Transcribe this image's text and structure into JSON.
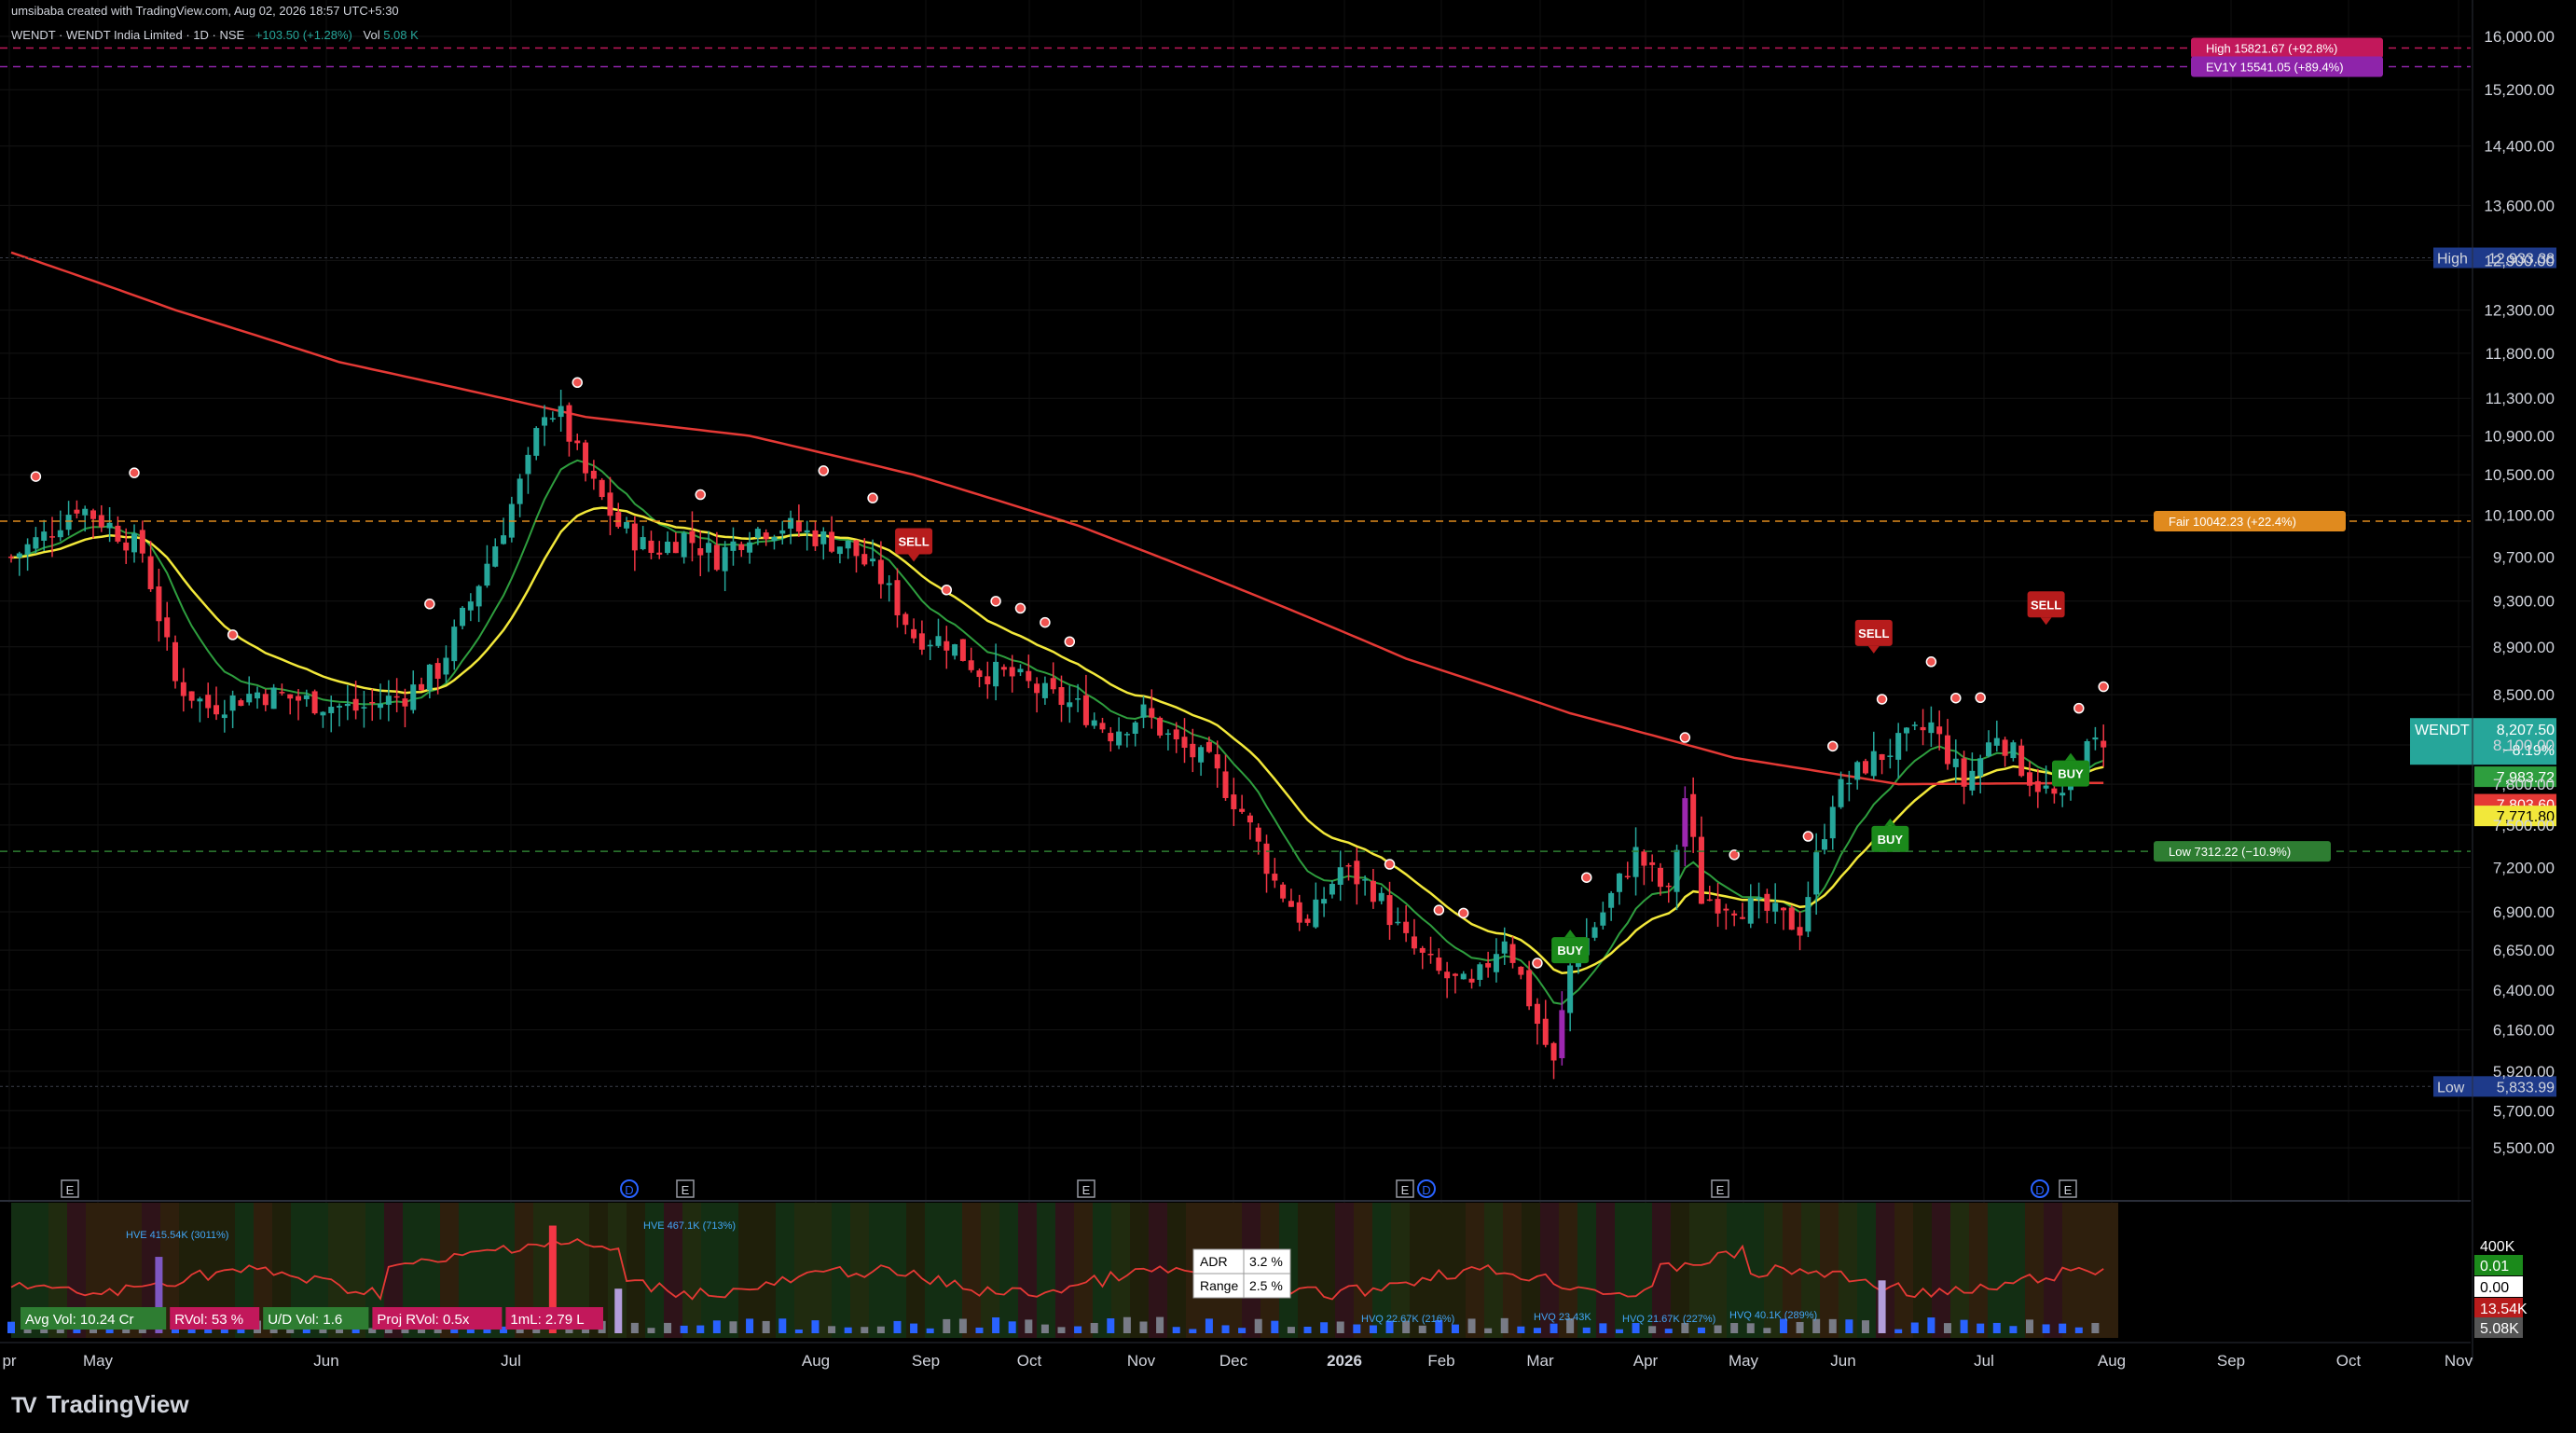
{
  "header": {
    "credit": "umsibaba created with TradingView.com, Aug 02, 2026 18:57 UTC+5:30",
    "title": "WENDT · WENDT India Limited · 1D · NSE",
    "change": "+103.50 (+1.28%)",
    "vol_label": "Vol",
    "vol_value": "5.08 K"
  },
  "brand": {
    "name": "TradingView",
    "logo": "tradingview-logo-icon"
  },
  "chart_data": {
    "type": "candlestick",
    "symbol": "WENDT",
    "y_ticks": [
      5500,
      5700,
      5920,
      6160,
      6400,
      6650,
      6900,
      7200,
      7500,
      7800,
      8100,
      8500,
      8900,
      9300,
      9700,
      10100,
      10500,
      10900,
      11300,
      11800,
      12300,
      12900,
      13600,
      14400,
      15200,
      16000
    ],
    "ylim": [
      5350,
      16100
    ],
    "scale": "log",
    "x_labels": [
      "pr",
      "May",
      "Jun",
      "Jul",
      "Aug",
      "Sep",
      "Oct",
      "Nov",
      "Dec",
      "2026",
      "Feb",
      "Mar",
      "Apr",
      "May",
      "Jun",
      "Jul",
      "Aug",
      "Sep",
      "Oct",
      "Nov"
    ],
    "series_close_anchors": [
      [
        0,
        9700
      ],
      [
        4,
        9900
      ],
      [
        8,
        10200
      ],
      [
        12,
        10000
      ],
      [
        16,
        9750
      ],
      [
        20,
        8600
      ],
      [
        24,
        8400
      ],
      [
        30,
        8520
      ],
      [
        36,
        8450
      ],
      [
        42,
        8380
      ],
      [
        48,
        8500
      ],
      [
        52,
        8700
      ],
      [
        56,
        9300
      ],
      [
        60,
        10000
      ],
      [
        63,
        10600
      ],
      [
        65,
        11200
      ],
      [
        67,
        11100
      ],
      [
        70,
        10500
      ],
      [
        74,
        10000
      ],
      [
        78,
        9750
      ],
      [
        82,
        9900
      ],
      [
        86,
        9700
      ],
      [
        90,
        9950
      ],
      [
        94,
        10000
      ],
      [
        98,
        9900
      ],
      [
        102,
        9800
      ],
      [
        106,
        9500
      ],
      [
        110,
        9000
      ],
      [
        114,
        8950
      ],
      [
        118,
        8700
      ],
      [
        122,
        8650
      ],
      [
        126,
        8500
      ],
      [
        130,
        8400
      ],
      [
        134,
        8200
      ],
      [
        138,
        8350
      ],
      [
        142,
        8100
      ],
      [
        146,
        7950
      ],
      [
        150,
        7600
      ],
      [
        154,
        7100
      ],
      [
        158,
        6800
      ],
      [
        162,
        7200
      ],
      [
        166,
        7050
      ],
      [
        170,
        6700
      ],
      [
        174,
        6500
      ],
      [
        178,
        6400
      ],
      [
        182,
        6750
      ],
      [
        186,
        6200
      ],
      [
        188,
        5950
      ],
      [
        190,
        6550
      ],
      [
        194,
        6900
      ],
      [
        198,
        7300
      ],
      [
        202,
        7000
      ],
      [
        204,
        7700
      ],
      [
        206,
        7000
      ],
      [
        210,
        6950
      ],
      [
        214,
        6900
      ],
      [
        218,
        6800
      ],
      [
        222,
        7700
      ],
      [
        226,
        7950
      ],
      [
        230,
        8100
      ],
      [
        234,
        8250
      ],
      [
        238,
        7800
      ],
      [
        242,
        8200
      ],
      [
        246,
        7850
      ],
      [
        250,
        7650
      ],
      [
        252,
        8000
      ],
      [
        256,
        8207.5
      ]
    ],
    "total_bars": 256,
    "ma_fast": {
      "name": "",
      "color": "#2e9e3e"
    },
    "ma_mid": {
      "name": "",
      "color": "#f2e83a"
    },
    "ma_slow": {
      "name": "",
      "color": "#e53935",
      "anchors": [
        [
          0,
          13000
        ],
        [
          20,
          12300
        ],
        [
          40,
          11700
        ],
        [
          55,
          11400
        ],
        [
          70,
          11100
        ],
        [
          90,
          10900
        ],
        [
          110,
          10500
        ],
        [
          130,
          10000
        ],
        [
          150,
          9400
        ],
        [
          170,
          8800
        ],
        [
          190,
          8350
        ],
        [
          210,
          8000
        ],
        [
          230,
          7800
        ],
        [
          256,
          7810
        ]
      ]
    },
    "markers": [
      {
        "type": "SELL",
        "bar": 110,
        "price": 9850
      },
      {
        "type": "SELL",
        "bar": 227,
        "price": 9020
      },
      {
        "type": "SELL",
        "bar": 248,
        "price": 9270
      },
      {
        "type": "BUY",
        "bar": 190,
        "price": 6650
      },
      {
        "type": "BUY",
        "bar": 229,
        "price": 7400
      },
      {
        "type": "BUY",
        "bar": 251,
        "price": 7880
      }
    ],
    "level_labels": [
      {
        "key": "high_ev",
        "text": "High 15821.67 (+92.8%)",
        "price": 15821.67,
        "color": "#c2185b"
      },
      {
        "key": "ev1y",
        "text": "EV1Y 15541.05 (+89.4%)",
        "price": 15541.05,
        "color": "#8e24aa",
        "icon": "diamond-icon"
      },
      {
        "key": "fair",
        "text": "Fair 10042.23 (+22.4%)",
        "price": 10042.23,
        "color": "#e08a1e"
      },
      {
        "key": "low",
        "text": "Low 7312.22 (−10.9%)",
        "price": 7312.22,
        "color": "#2e7d32"
      }
    ],
    "high_marker": {
      "label": "High",
      "value": "12,933.38",
      "price": 12933.38
    },
    "low_marker": {
      "label": "Low",
      "value": "5,833.99",
      "price": 5833.99
    },
    "price_badges": [
      {
        "text": "WENDT",
        "sub": "8,207.50",
        "sub2": "−8.19%",
        "price": 8207.5,
        "color": "#26a69a"
      },
      {
        "text": "7,983.72",
        "price": 7983.72,
        "color": "#2e9e3e"
      },
      {
        "text": "7,803.60",
        "price": 7803.6,
        "color": "#e53935"
      },
      {
        "text": "7,771.80",
        "price": 7771.8,
        "color": "#f2e83a"
      }
    ],
    "event_markers": [
      "E",
      "D",
      "E",
      "E",
      "E",
      "D",
      "E",
      "D",
      "E"
    ],
    "sub_panel": {
      "axis_labels": [
        "400K",
        "0.01",
        "0.00",
        "13.54K",
        "5.08K"
      ],
      "stats": [
        {
          "label": "Avg Vol: 10.24 Cr",
          "color": "#2e7d32"
        },
        {
          "label": "RVol: 53 %",
          "color": "#c2185b"
        },
        {
          "label": "U/D Vol: 1.6",
          "color": "#2e7d32"
        },
        {
          "label": "Proj RVol: 0.5x",
          "color": "#c2185b"
        },
        {
          "label": "1mL: 2.79 L",
          "color": "#c2185b"
        }
      ],
      "adr_table": [
        [
          "ADR",
          "3.2 %"
        ],
        [
          "Range",
          "2.5 %"
        ]
      ],
      "hve_labels": [
        "HVE 415.54K (3011%)",
        "HVE 467.1K (713%)"
      ],
      "hvq_labels": [
        "HVQ 22.67K (216%)",
        "HVQ 23.43K",
        "HVQ 21.67K (227%)",
        "HVQ 40.1K (289%)"
      ]
    }
  }
}
